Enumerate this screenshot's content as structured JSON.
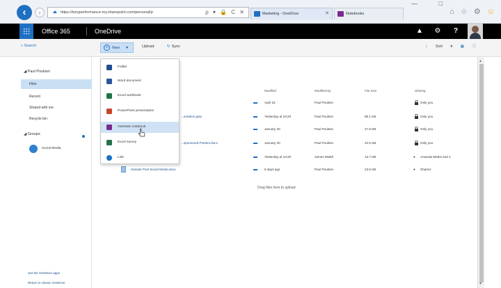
{
  "browser": {
    "back_icon": "back-arrow-icon",
    "url": "https://tonyperformance-my.sharepoint.com/personal/p",
    "addr_icons": "ρ ▾ 🔒 C ✕",
    "tabs": [
      {
        "label": "Marketing - OneDrive",
        "icon_color": "#1f6fc2",
        "close": "✕"
      },
      {
        "label": "Notebooks",
        "icon_color": "#7a2b8e",
        "close": ""
      }
    ],
    "window_controls": "— □",
    "toolbar_icons": "⌂ ☆ ⚙",
    "smiley": "☺"
  },
  "suitebar": {
    "brand": "Office 365",
    "app": "OneDrive",
    "bell_icon": "🔔",
    "settings_icon": "⚙",
    "help_icon": "?"
  },
  "commandbar": {
    "search": "Search",
    "new_label": "New",
    "new_chevron": "▾",
    "upload": "Upload",
    "sync": "Sync",
    "sort": "Sort",
    "sort_chevron": "▾",
    "view_icon": "▦",
    "info_icon": "ⓘ"
  },
  "leftnav": {
    "user": "Paul Poulsen",
    "user_toggle": "◢",
    "items": [
      {
        "label": "Files",
        "selected": true
      },
      {
        "label": "Recent",
        "selected": false
      },
      {
        "label": "Shared with me",
        "selected": false
      },
      {
        "label": "Recycle bin",
        "selected": false
      }
    ],
    "groups_label": "Groups",
    "groups_toggle": "◢",
    "group_item": "Social Media",
    "footer": [
      "Get the OneDrive apps",
      "Return to classic OneDrive"
    ]
  },
  "new_menu": {
    "items": [
      {
        "label": "Folder",
        "color": "#1f4f8a"
      },
      {
        "label": "Word document",
        "color": "#2b579a"
      },
      {
        "label": "Excel workbook",
        "color": "#217346"
      },
      {
        "label": "PowerPoint presentation",
        "color": "#c9462b"
      },
      {
        "label": "OneNote notebook",
        "color": "#7a2b8e"
      },
      {
        "label": "Excel survey",
        "color": "#217346"
      },
      {
        "label": "Link",
        "color": "#1f6fc2"
      }
    ]
  },
  "file_list": {
    "columns": [
      "Modified",
      "Modified By",
      "File Size",
      "Sharing"
    ],
    "rows": [
      {
        "name": "",
        "modified": "April 15",
        "modified_by": "Paul Poulsen",
        "size": "",
        "sharing": "Only you"
      },
      {
        "name": "...entation.pptx",
        "modified": "Yesterday at 10:20",
        "modified_by": "Paul Poulsen",
        "size": "88.1 KB",
        "sharing": "Only you"
      },
      {
        "name": "",
        "modified": "January 20",
        "modified_by": "Paul Poulsen",
        "size": "27.5 KB",
        "sharing": "Only you"
      },
      {
        "name": "...sponsored Postsrs.docx",
        "modified": "January 20",
        "modified_by": "Paul Poulsen",
        "size": "22.5 KB",
        "sharing": "Only you"
      },
      {
        "name": "",
        "modified": "Yesterday at 10:20",
        "modified_by": "James Walsh",
        "size": "13.7 KB",
        "sharing": "Amanda Marks and 1"
      },
      {
        "name": "Sample Post Social Media.docx",
        "modified": "6 days ago",
        "modified_by": "Paul Poulsen",
        "size": "23.6 KB",
        "sharing": "Shared"
      }
    ],
    "drop_hint": "Drag files here to upload"
  }
}
